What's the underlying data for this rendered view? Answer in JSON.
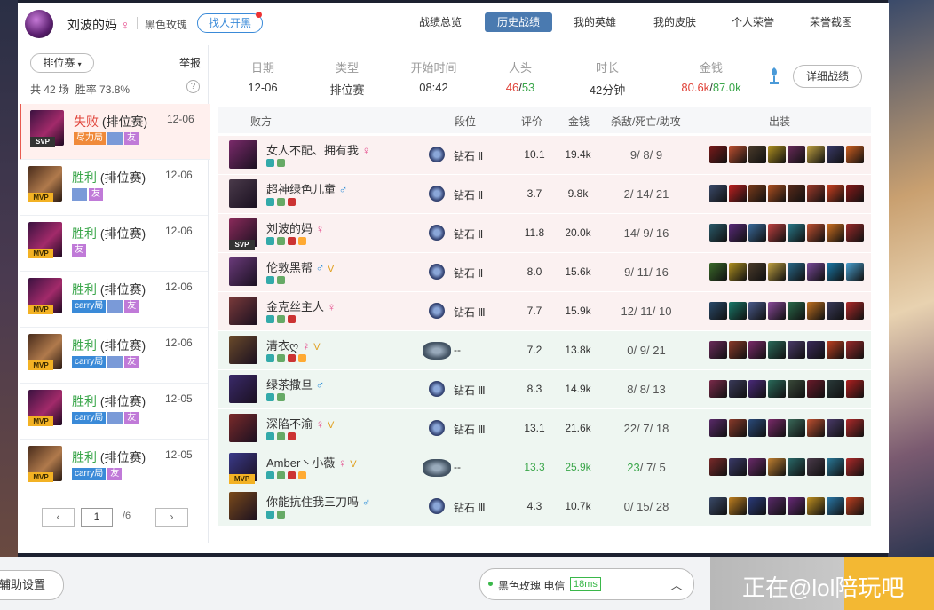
{
  "profile": {
    "name": "刘波的妈",
    "gender_icon": "female-symbol",
    "server": "黑色玫瑰",
    "find_black_label": "找人开黑"
  },
  "nav_tabs": [
    {
      "label": "战绩总览",
      "active": false
    },
    {
      "label": "历史战绩",
      "active": true
    },
    {
      "label": "我的英雄",
      "active": false
    },
    {
      "label": "我的皮肤",
      "active": false
    },
    {
      "label": "个人荣誉",
      "active": false
    },
    {
      "label": "荣誉截图",
      "active": false
    }
  ],
  "filter": {
    "mode": "排位赛",
    "report_label": "举报",
    "stats_prefix": "共 42 场",
    "stats_winrate": "胜率 73.8%",
    "help": "?"
  },
  "match_list": [
    {
      "result": "失败",
      "type": "(排位赛)",
      "date": "12-06",
      "badge": "SVP",
      "tags": [
        "尽力局",
        "img",
        "友"
      ],
      "champ": "eve",
      "selected": true
    },
    {
      "result": "胜利",
      "type": "(排位赛)",
      "date": "12-06",
      "badge": "MVP",
      "tags": [
        "img",
        "友"
      ],
      "champ": "dar",
      "selected": false
    },
    {
      "result": "胜利",
      "type": "(排位赛)",
      "date": "12-06",
      "badge": "MVP",
      "tags": [
        "友"
      ],
      "champ": "eve",
      "selected": false
    },
    {
      "result": "胜利",
      "type": "(排位赛)",
      "date": "12-06",
      "badge": "MVP",
      "tags": [
        "carry局",
        "img",
        "友"
      ],
      "champ": "eve",
      "selected": false
    },
    {
      "result": "胜利",
      "type": "(排位赛)",
      "date": "12-06",
      "badge": "MVP",
      "tags": [
        "carry局",
        "img",
        "友"
      ],
      "champ": "dar",
      "selected": false
    },
    {
      "result": "胜利",
      "type": "(排位赛)",
      "date": "12-05",
      "badge": "MVP",
      "tags": [
        "carry局",
        "img",
        "友"
      ],
      "champ": "eve",
      "selected": false
    },
    {
      "result": "胜利",
      "type": "(排位赛)",
      "date": "12-05",
      "badge": "MVP",
      "tags": [
        "carry局",
        "友"
      ],
      "champ": "dar",
      "selected": false
    }
  ],
  "pager": {
    "prev": "‹",
    "current": "1",
    "total": "/6",
    "next": "›"
  },
  "summary": {
    "date": {
      "label": "日期",
      "value": "12-06"
    },
    "type": {
      "label": "类型",
      "value": "排位赛"
    },
    "start": {
      "label": "开始时间",
      "value": "08:42"
    },
    "kills": {
      "label": "人头",
      "value_a": "46",
      "sep": "/",
      "value_b": "53"
    },
    "duration": {
      "label": "时长",
      "value": "42分钟"
    },
    "gold": {
      "label": "金钱",
      "value_a": "80.6k",
      "sep": "/",
      "value_b": "87.0k"
    },
    "detail_label": "详细战绩"
  },
  "table_headers": {
    "team": "败方",
    "rank": "段位",
    "score": "评价",
    "gold": "金钱",
    "kda": "杀敌/死亡/助攻",
    "items": "出装"
  },
  "players": [
    {
      "name": "女人不配、拥有我",
      "gender": "♀",
      "rank": "钻石 Ⅱ",
      "score": "10.1",
      "gold": "19.4k",
      "k": "9",
      "d": "8",
      "a": "9",
      "team": "lose",
      "badge": "",
      "extra": "",
      "ava": "#7a2a6a",
      "hl": false
    },
    {
      "name": "超神绿色儿童",
      "gender": "♂",
      "rank": "钻石 Ⅱ",
      "score": "3.7",
      "gold": "9.8k",
      "k": "2",
      "d": "14",
      "a": "21",
      "team": "lose",
      "badge": "",
      "extra": "",
      "ava": "#4a3a4a",
      "hl": false
    },
    {
      "name": "刘波的妈",
      "gender": "♀",
      "rank": "钻石 Ⅱ",
      "score": "11.8",
      "gold": "20.0k",
      "k": "14",
      "d": "9",
      "a": "16",
      "team": "lose",
      "badge": "SVP",
      "extra": "",
      "ava": "#8a2a5a",
      "hl": false
    },
    {
      "name": "伦敦黑帮",
      "gender": "♂",
      "rank": "钻石 Ⅱ",
      "score": "8.0",
      "gold": "15.6k",
      "k": "9",
      "d": "11",
      "a": "16",
      "team": "lose",
      "badge": "",
      "extra": "V",
      "ava": "#6a3a7a",
      "hl": false
    },
    {
      "name": "金克丝主人",
      "gender": "♀",
      "rank": "钻石 Ⅲ",
      "score": "7.7",
      "gold": "15.9k",
      "k": "12",
      "d": "11",
      "a": "10",
      "team": "lose",
      "badge": "",
      "extra": "",
      "ava": "#7a3a3a",
      "hl": false
    },
    {
      "name": "清衣ღ",
      "gender": "♀",
      "rank": "--",
      "score": "7.2",
      "gold": "13.8k",
      "k": "0",
      "d": "9",
      "a": "21",
      "team": "win",
      "badge": "",
      "extra": "V",
      "ava": "#6a4a2a",
      "hl": false
    },
    {
      "name": "绿茶撒旦",
      "gender": "♂",
      "rank": "钻石 Ⅲ",
      "score": "8.3",
      "gold": "14.9k",
      "k": "8",
      "d": "8",
      "a": "13",
      "team": "win",
      "badge": "",
      "extra": "",
      "ava": "#3a2a6a",
      "hl": false
    },
    {
      "name": "深陷不渝",
      "gender": "♀",
      "rank": "钻石 Ⅲ",
      "score": "13.1",
      "gold": "21.6k",
      "k": "22",
      "d": "7",
      "a": "18",
      "team": "win",
      "badge": "",
      "extra": "V",
      "ava": "#7a2a2a",
      "hl": false
    },
    {
      "name": "Amber丶小薇",
      "gender": "♀",
      "rank": "--",
      "score": "13.3",
      "gold": "25.9k",
      "k": "23",
      "d": "7",
      "a": "5",
      "team": "win",
      "badge": "MVP",
      "extra": "V",
      "ava": "#3a3a8a",
      "hl": true
    },
    {
      "name": "你能抗住我三刀吗",
      "gender": "♂",
      "rank": "钻石 Ⅲ",
      "score": "4.3",
      "gold": "10.7k",
      "k": "0",
      "d": "15",
      "a": "28",
      "team": "win",
      "badge": "",
      "extra": "",
      "ava": "#7a4a1a",
      "hl": false
    }
  ],
  "bottom": {
    "assist_label": "辅助设置",
    "status_text": "黑色玫瑰 电信",
    "ping": "18ms",
    "watermark": "正在@lol陪玩吧"
  }
}
